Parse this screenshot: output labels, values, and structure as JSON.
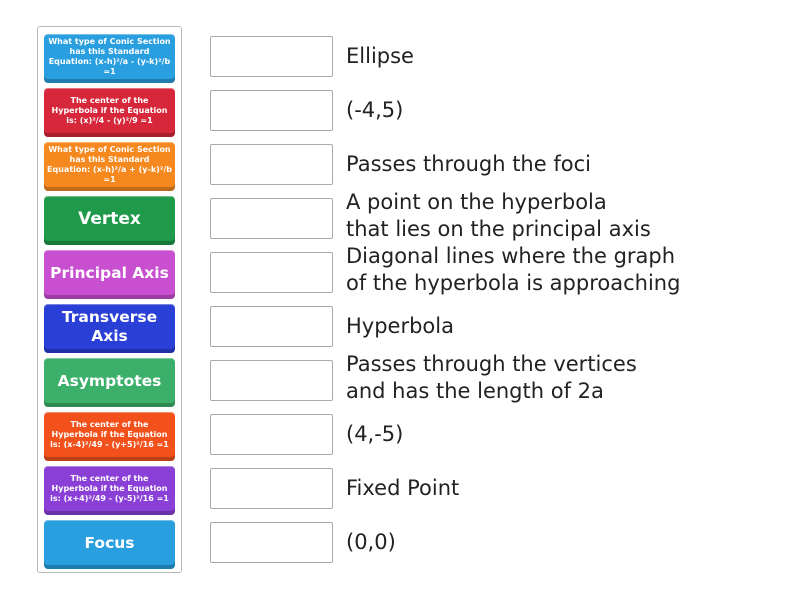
{
  "tiles": [
    {
      "text": "What type of Conic Section has this Standard Equation: (x-h)²/a - (y-k)²/b =1",
      "color": "#2a9fe0"
    },
    {
      "text": "The center of the Hyperbola if the Equation is: (x)²/4 - (y)²/9 =1",
      "color": "#d6283a"
    },
    {
      "text": "What type of Conic Section has this Standard Equation: (x-h)²/a + (y-k)²/b =1",
      "color": "#f5881f"
    },
    {
      "text": "Vertex",
      "color": "#1f9a4a"
    },
    {
      "text": "Principal Axis",
      "color": "#c74fd0"
    },
    {
      "text": "Transverse Axis",
      "color": "#2a3fd6"
    },
    {
      "text": "Asymptotes",
      "color": "#3cb06a"
    },
    {
      "text": "The center of the Hyperbola if the Equation is: (x-4)²/49 - (y+5)²/16 =1",
      "color": "#f2511b"
    },
    {
      "text": "The center of the Hyperbola if the Equation is: (x+4)²/49 - (y-5)²/16 =1",
      "color": "#8a3fd6"
    },
    {
      "text": "Focus",
      "color": "#2a9fe0"
    }
  ],
  "answers": [
    "Ellipse",
    "(-4,5)",
    "Passes through the foci",
    "A point on the hyperbola\nthat lies on the principal axis",
    "Diagonal lines where the graph\nof the hyperbola is approaching",
    "Hyperbola",
    "Passes through the vertices\nand has the length of 2a",
    "(4,-5)",
    "Fixed Point",
    "(0,0)"
  ]
}
